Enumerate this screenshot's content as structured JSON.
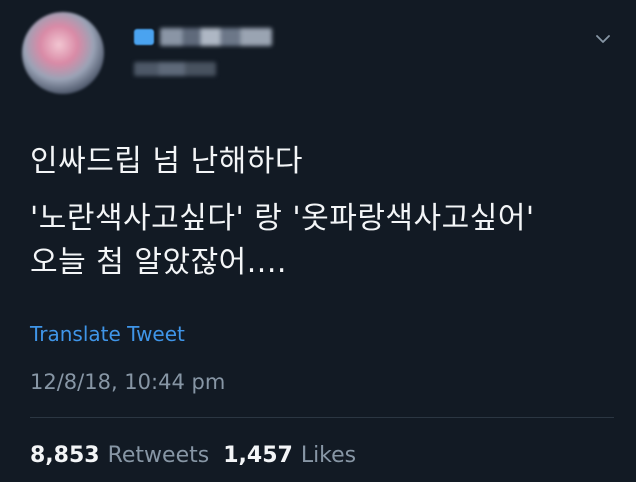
{
  "tweet": {
    "lines": [
      "인싸드립 넘 난해하다",
      "'노란색사고싶다' 랑 '옷파랑색사고싶어'",
      "오늘 첨 알았잖어...."
    ],
    "translate_label": "Translate Tweet",
    "timestamp": "12/8/18, 10:44 pm",
    "retweets": {
      "count": "8,853",
      "label": "Retweets"
    },
    "likes": {
      "count": "1,457",
      "label": "Likes"
    }
  },
  "colors": {
    "background": "#121a24",
    "link": "#3f95e8",
    "muted": "#8796a5",
    "text": "#f3f5f7"
  },
  "icons": {
    "menu": "chevron-down-icon"
  }
}
